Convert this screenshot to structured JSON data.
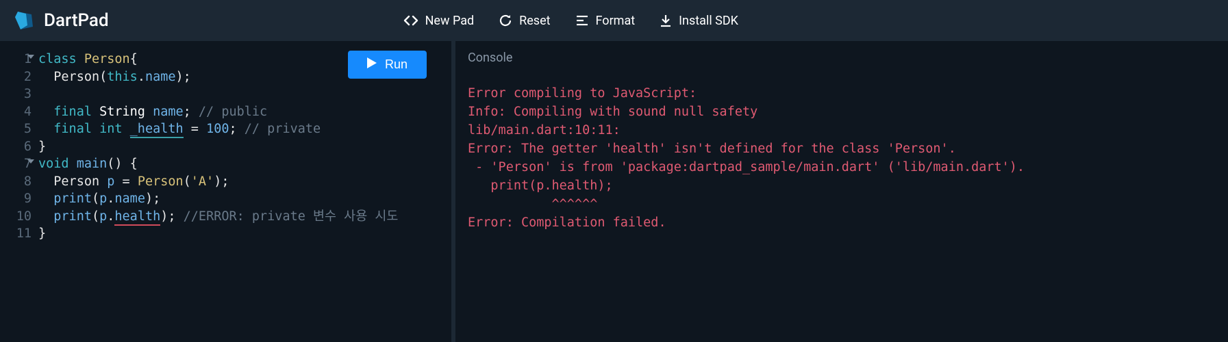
{
  "header": {
    "title": "DartPad",
    "buttons": {
      "newpad": "New Pad",
      "reset": "Reset",
      "format": "Format",
      "install": "Install SDK"
    }
  },
  "editor": {
    "run_label": "Run",
    "lines": [
      {
        "n": "1",
        "fold": true,
        "tokens": [
          [
            "kw",
            "class "
          ],
          [
            "cls",
            "Person"
          ],
          [
            "white",
            "{"
          ]
        ]
      },
      {
        "n": "2",
        "tokens": [
          [
            "white",
            "  Person("
          ],
          [
            "thiskw",
            "this"
          ],
          [
            "white",
            "."
          ],
          [
            "prop",
            "name"
          ],
          [
            "white",
            ");"
          ]
        ]
      },
      {
        "n": "3",
        "tokens": [
          [
            "white",
            ""
          ]
        ]
      },
      {
        "n": "4",
        "tokens": [
          [
            "white",
            "  "
          ],
          [
            "kw",
            "final "
          ],
          [
            "name-def",
            "String "
          ],
          [
            "prop",
            "name"
          ],
          [
            "white",
            "; "
          ],
          [
            "cmt",
            "// public"
          ]
        ]
      },
      {
        "n": "5",
        "tokens": [
          [
            "white",
            "  "
          ],
          [
            "kw",
            "final "
          ],
          [
            "type",
            "int "
          ],
          [
            "prop under-teal",
            "_health"
          ],
          [
            "white",
            " = "
          ],
          [
            "num",
            "100"
          ],
          [
            "white",
            "; "
          ],
          [
            "cmt",
            "// private"
          ]
        ]
      },
      {
        "n": "6",
        "tokens": [
          [
            "white",
            "}"
          ]
        ]
      },
      {
        "n": "7",
        "fold": true,
        "tokens": [
          [
            "type",
            "void "
          ],
          [
            "fn",
            "main"
          ],
          [
            "white",
            "() {"
          ]
        ]
      },
      {
        "n": "8",
        "tokens": [
          [
            "white",
            "  Person "
          ],
          [
            "prop",
            "p"
          ],
          [
            "white",
            " = "
          ],
          [
            "cls",
            "Person"
          ],
          [
            "white",
            "("
          ],
          [
            "str",
            "'A'"
          ],
          [
            "white",
            ");"
          ]
        ]
      },
      {
        "n": "9",
        "tokens": [
          [
            "white",
            "  "
          ],
          [
            "fn",
            "print"
          ],
          [
            "white",
            "("
          ],
          [
            "prop",
            "p"
          ],
          [
            "white",
            "."
          ],
          [
            "prop",
            "name"
          ],
          [
            "white",
            ");"
          ]
        ]
      },
      {
        "n": "10",
        "tokens": [
          [
            "white",
            "  "
          ],
          [
            "fn",
            "print"
          ],
          [
            "white",
            "("
          ],
          [
            "prop",
            "p"
          ],
          [
            "white",
            "."
          ],
          [
            "prop under-red",
            "health"
          ],
          [
            "white",
            "); "
          ],
          [
            "cmt",
            "//ERROR: private 변수 사용 시도"
          ]
        ]
      },
      {
        "n": "11",
        "tokens": [
          [
            "white",
            "}"
          ]
        ]
      }
    ]
  },
  "console": {
    "title": "Console",
    "output": "Error compiling to JavaScript:\nInfo: Compiling with sound null safety\nlib/main.dart:10:11:\nError: The getter 'health' isn't defined for the class 'Person'.\n - 'Person' is from 'package:dartpad_sample/main.dart' ('lib/main.dart').\n   print(p.health);\n           ^^^^^^\nError: Compilation failed."
  }
}
